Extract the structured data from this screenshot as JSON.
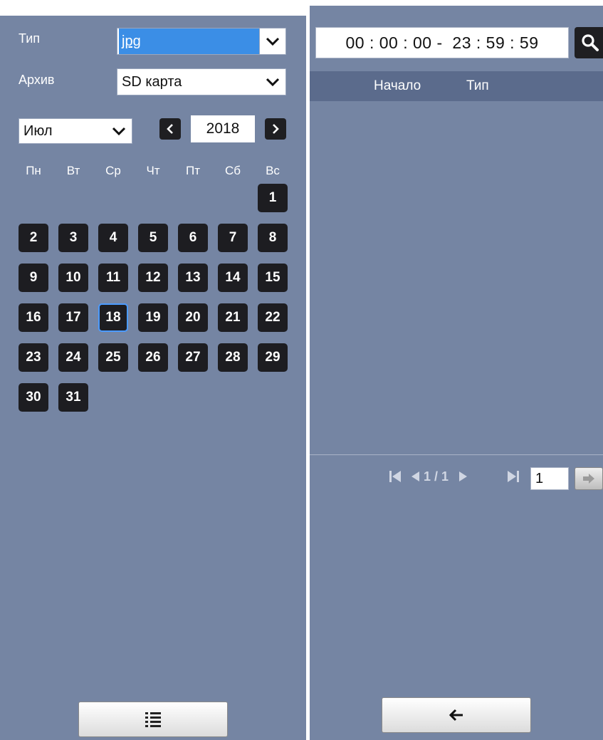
{
  "filters": {
    "type_label": "Тип",
    "type_value": "jpg",
    "archive_label": "Архив",
    "archive_value": "SD карта"
  },
  "calendar": {
    "month": "Июл",
    "year": "2018",
    "weekdays": [
      "Пн",
      "Вт",
      "Ср",
      "Чт",
      "Пт",
      "Сб",
      "Вс"
    ],
    "days": [
      "1",
      "2",
      "3",
      "4",
      "5",
      "6",
      "7",
      "8",
      "9",
      "10",
      "11",
      "12",
      "13",
      "14",
      "15",
      "16",
      "17",
      "18",
      "19",
      "20",
      "21",
      "22",
      "23",
      "24",
      "25",
      "26",
      "27",
      "28",
      "29",
      "30",
      "31"
    ],
    "selected_day": "18"
  },
  "time_range": {
    "display": "00 : 00 : 00 -  23 : 59 : 59"
  },
  "table": {
    "columns": [
      "Начало",
      "Тип"
    ]
  },
  "pager": {
    "page_info": "1 / 1",
    "page_input": "1"
  },
  "icons": {
    "list": "list-icon",
    "back": "arrow-left-icon",
    "search": "search-icon",
    "first": "first-page-icon",
    "prev": "prev-page-icon",
    "next": "next-page-icon",
    "last": "last-page-icon",
    "go": "go-arrow-icon"
  },
  "colors": {
    "panel": "#7585a3",
    "header": "#5b6b8c",
    "day_bg": "#1d1d21",
    "selected_border": "#4b9bff",
    "highlight": "#3b8ee6"
  }
}
